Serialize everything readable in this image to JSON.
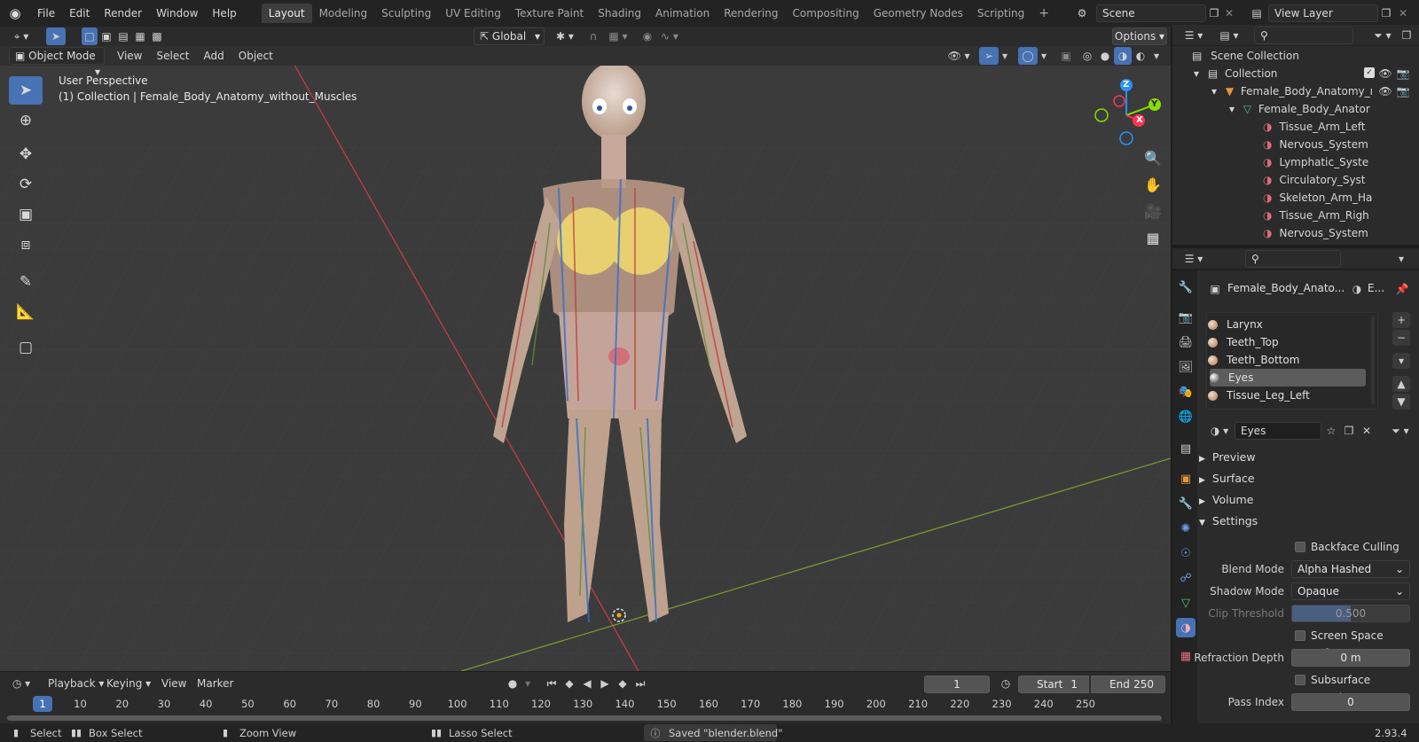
{
  "topbar": {
    "menus": [
      "File",
      "Edit",
      "Render",
      "Window",
      "Help"
    ],
    "workspaces": [
      "Layout",
      "Modeling",
      "Sculpting",
      "UV Editing",
      "Texture Paint",
      "Shading",
      "Animation",
      "Rendering",
      "Compositing",
      "Geometry Nodes",
      "Scripting"
    ],
    "active_workspace": "Layout",
    "scene": "Scene",
    "view_layer": "View Layer"
  },
  "viewport_header": {
    "orientation": "Global",
    "options": "Options",
    "mode": "Object Mode",
    "menus": [
      "View",
      "Select",
      "Add",
      "Object"
    ]
  },
  "viewport": {
    "perspective": "User Perspective",
    "collection_info": "(1) Collection | Female_Body_Anatomy_without_Muscles",
    "gizmo": {
      "z": "Z",
      "y": "Y",
      "x": "X"
    }
  },
  "outliner": {
    "rows": [
      {
        "label": "Scene Collection",
        "indent": 0
      },
      {
        "label": "Collection",
        "indent": 1
      },
      {
        "label": "Female_Body_Anatomy_ı",
        "indent": 2
      },
      {
        "label": "Female_Body_Anator",
        "indent": 3
      },
      {
        "label": "Tissue_Arm_Left",
        "indent": 4
      },
      {
        "label": "Nervous_System",
        "indent": 4
      },
      {
        "label": "Lymphatic_Syste",
        "indent": 4
      },
      {
        "label": "Circulatory_Syst",
        "indent": 4
      },
      {
        "label": "Skeleton_Arm_Ha",
        "indent": 4
      },
      {
        "label": "Tissue_Arm_Righ",
        "indent": 4
      },
      {
        "label": "Nervous_System",
        "indent": 4
      }
    ]
  },
  "properties": {
    "object_name": "Female_Body_Anato...",
    "material_short": "E...",
    "materials": [
      "Larynx",
      "Teeth_Top",
      "Teeth_Bottom",
      "Eyes",
      "Tissue_Leg_Left"
    ],
    "selected_material_index": 3,
    "material_field": "Eyes",
    "panels": {
      "preview": "Preview",
      "surface": "Surface",
      "volume": "Volume",
      "settings": "Settings"
    },
    "settings": {
      "backface_culling": "Backface Culling",
      "blend_mode_label": "Blend Mode",
      "blend_mode": "Alpha Hashed",
      "shadow_mode_label": "Shadow Mode",
      "shadow_mode": "Opaque",
      "clip_threshold_label": "Clip Threshold",
      "clip_threshold": "0.500",
      "clip_threshold_fill": 0.5,
      "ssr": "Screen Space Refract...",
      "refraction_depth_label": "Refraction Depth",
      "refraction_depth": "0 m",
      "sss": "Subsurface Transluce...",
      "pass_index_label": "Pass Index",
      "pass_index": "0"
    }
  },
  "timeline": {
    "menus": [
      "Playback",
      "Keying",
      "View",
      "Marker"
    ],
    "current_frame": "1",
    "start_label": "Start",
    "start": "1",
    "end_label": "End",
    "end": "250",
    "ticks": [
      "1",
      "10",
      "20",
      "30",
      "40",
      "50",
      "60",
      "70",
      "80",
      "90",
      "100",
      "110",
      "120",
      "130",
      "140",
      "150",
      "160",
      "170",
      "180",
      "190",
      "200",
      "210",
      "220",
      "230",
      "240",
      "250"
    ]
  },
  "statusbar": {
    "select": "Select",
    "box_select": "Box Select",
    "zoom_view": "Zoom View",
    "lasso_select": "Lasso Select",
    "message": "Saved \"blender.blend\"",
    "version": "2.93.4"
  },
  "colors": {
    "accent": "#4772b3",
    "x_axis": "#ff3352",
    "y_axis": "#8bdc00",
    "z_axis": "#2890ff"
  }
}
